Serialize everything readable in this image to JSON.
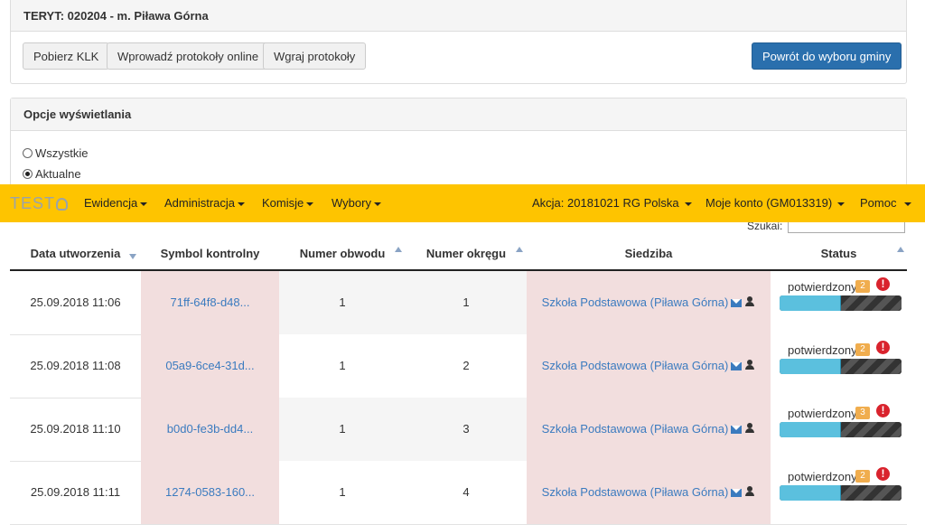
{
  "header_panel": {
    "title": "TERYT: 020204 - m. Piława Górna",
    "buttons": {
      "download_klk": "Pobierz KLK",
      "enter_online": "Wprowadź protokoły online",
      "upload": "Wgraj protokoły",
      "back": "Powrót do wyboru gminy"
    }
  },
  "display_options": {
    "title": "Opcje wyświetlania",
    "options": [
      "Wszystkie",
      "Aktualne"
    ],
    "selected": "Aktualne"
  },
  "navbar": {
    "brand": "TEST",
    "menu": [
      "Ewidencja",
      "Administracja",
      "Komisje",
      "Wybory"
    ],
    "action": "Akcja: 20181021 RG Polska",
    "account": "Moje konto (GM013319)",
    "help": "Pomoc",
    "color": "#fec400"
  },
  "search": {
    "label": "Szukaj:",
    "value": ""
  },
  "table": {
    "columns": [
      "Data utworzenia",
      "Symbol kontrolny",
      "Numer obwodu",
      "Numer okręgu",
      "Siedziba",
      "Status"
    ],
    "rows": [
      {
        "date": "25.09.2018 11:06",
        "symbol": "71ff-64f8-d48...",
        "obwod": "1",
        "okreg": "1",
        "siedziba": "Szkoła Podstawowa (Piława Górna)",
        "status": "potwierdzony",
        "badge": "2",
        "warn": "!",
        "progress": 0.5
      },
      {
        "date": "25.09.2018 11:08",
        "symbol": "05a9-6ce4-31d...",
        "obwod": "1",
        "okreg": "2",
        "siedziba": "Szkoła Podstawowa (Piława Górna)",
        "status": "potwierdzony",
        "badge": "2",
        "warn": "!",
        "progress": 0.5
      },
      {
        "date": "25.09.2018 11:10",
        "symbol": "b0d0-fe3b-dd4...",
        "obwod": "1",
        "okreg": "3",
        "siedziba": "Szkoła Podstawowa (Piława Górna)",
        "status": "potwierdzony",
        "badge": "3",
        "warn": "!",
        "progress": 0.5
      },
      {
        "date": "25.09.2018 11:11",
        "symbol": "1274-0583-160...",
        "obwod": "1",
        "okreg": "4",
        "siedziba": "Szkoła Podstawowa (Piława Górna)",
        "status": "potwierdzony",
        "badge": "2",
        "warn": "!",
        "progress": 0.5
      }
    ]
  }
}
